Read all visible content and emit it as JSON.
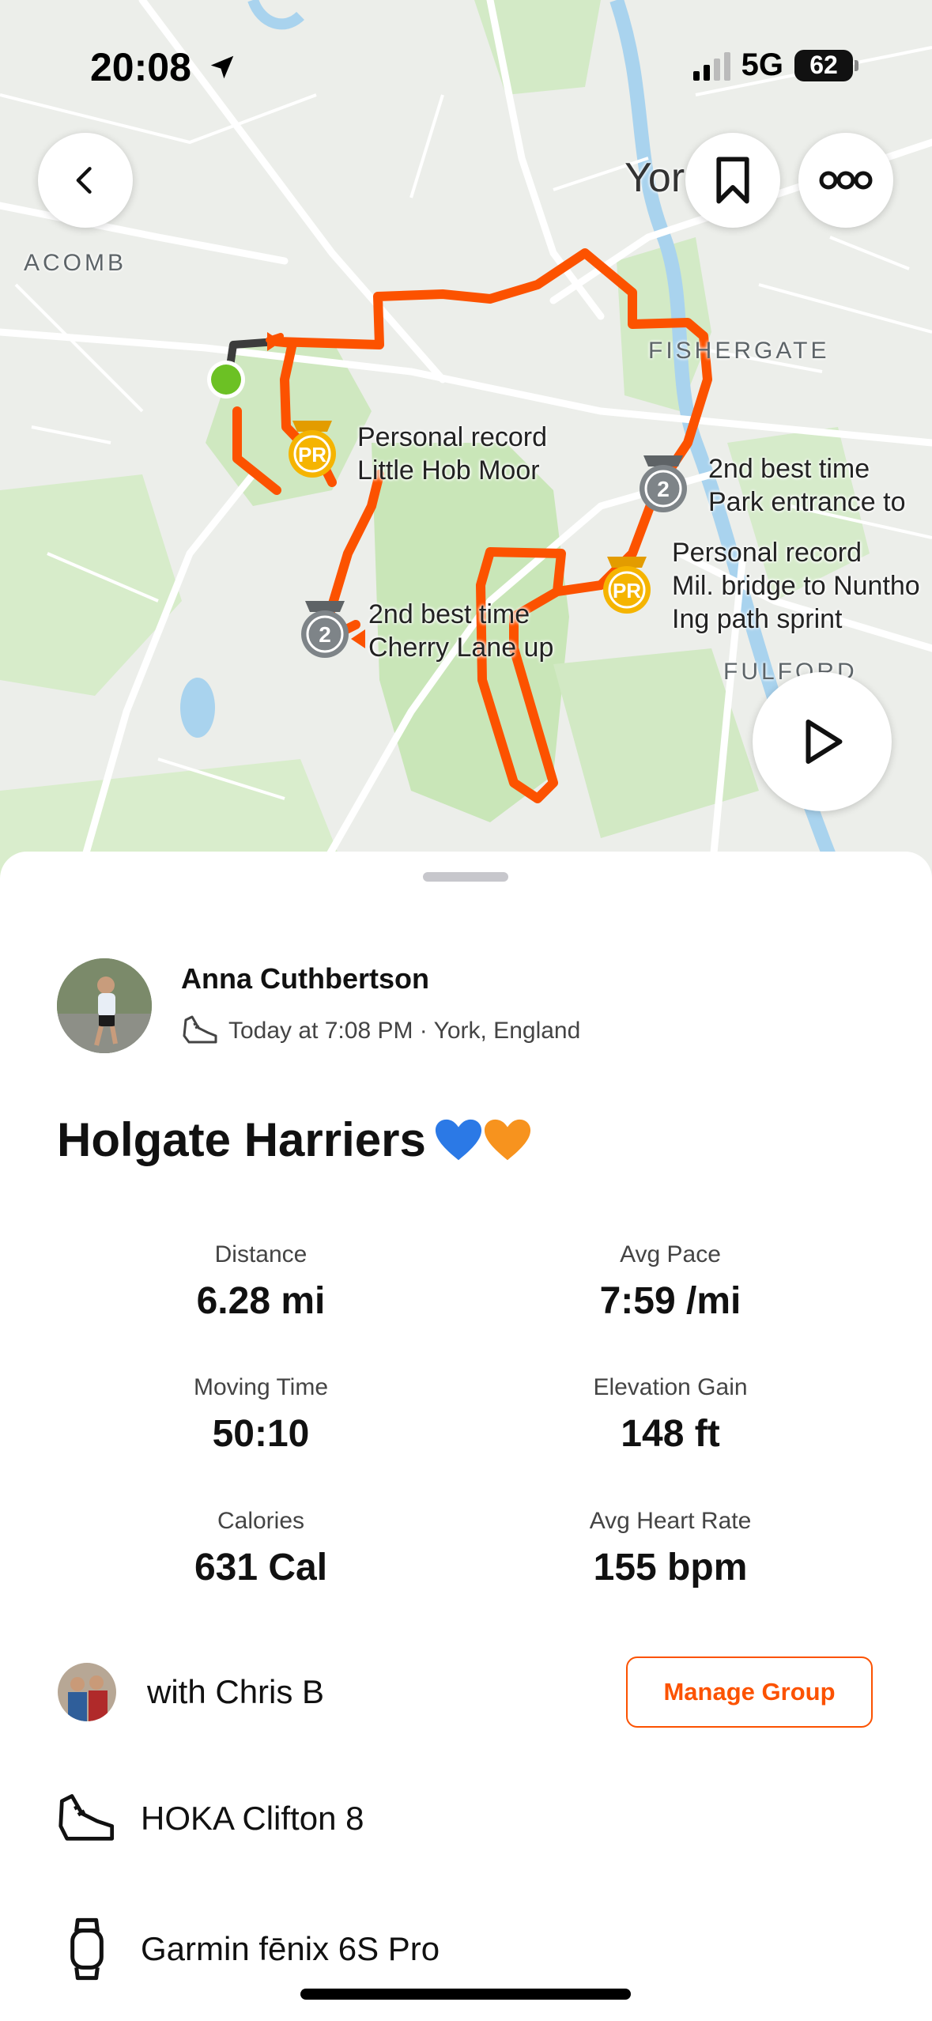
{
  "status_bar": {
    "time": "20:08",
    "network": "5G",
    "battery": "62"
  },
  "map": {
    "place_labels": {
      "acomb": "ACOMB",
      "york": "Yor",
      "fishergate": "FISHERGATE",
      "fulford": "FULFORD"
    },
    "segments": [
      {
        "badge": "PR",
        "line1": "Personal record",
        "line2": "Little Hob Moor",
        "line3": ""
      },
      {
        "badge": "2",
        "line1": "2nd best time",
        "line2": "Park entrance to",
        "line3": ""
      },
      {
        "badge": "PR",
        "line1": "Personal record",
        "line2": "Mil. bridge to Nuntho",
        "line3": "Ing path sprint"
      },
      {
        "badge": "2",
        "line1": "2nd best time",
        "line2": "Cherry Lane up",
        "line3": ""
      }
    ],
    "colors": {
      "route": "#fc5200",
      "start": "#6cc124",
      "pr_badge": "#f5b400",
      "second_badge": "#7e8488"
    }
  },
  "activity": {
    "athlete_name": "Anna Cuthbertson",
    "meta": "Today at 7:08 PM · York, England",
    "title": "Holgate Harriers",
    "stats": [
      {
        "label": "Distance",
        "value": "6.28 mi"
      },
      {
        "label": "Avg Pace",
        "value": "7:59 /mi"
      },
      {
        "label": "Moving Time",
        "value": "50:10"
      },
      {
        "label": "Elevation Gain",
        "value": "148 ft"
      },
      {
        "label": "Calories",
        "value": "631 Cal"
      },
      {
        "label": "Avg Heart Rate",
        "value": "155 bpm"
      }
    ],
    "group": {
      "with_text": "with Chris B",
      "manage_label": "Manage Group"
    },
    "gear": {
      "shoes": "HOKA Clifton 8",
      "device": "Garmin fēnix 6S Pro"
    }
  },
  "icons": [
    "back-icon",
    "bookmark-icon",
    "more-icon",
    "play-icon",
    "location-arrow-icon",
    "run-shoe-icon",
    "watch-icon"
  ]
}
